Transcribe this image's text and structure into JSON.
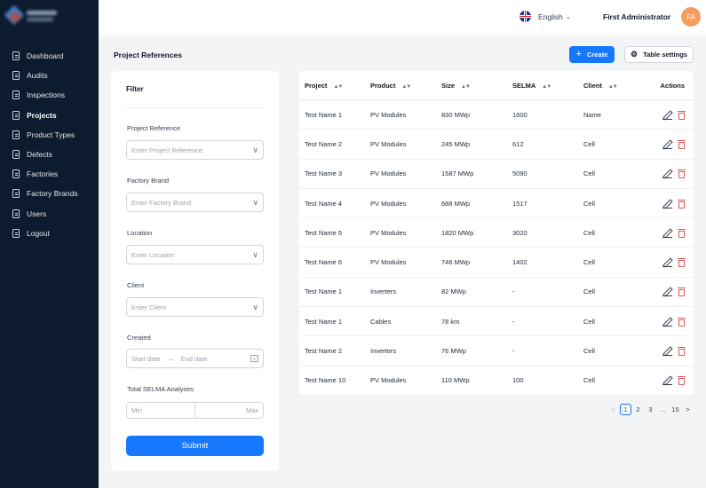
{
  "nav": {
    "items": [
      {
        "label": "Dashboard",
        "active": false
      },
      {
        "label": "Audits",
        "active": false
      },
      {
        "label": "Inspections",
        "active": false
      },
      {
        "label": "Projects",
        "active": true
      },
      {
        "label": "Product Types",
        "active": false
      },
      {
        "label": "Defects",
        "active": false
      },
      {
        "label": "Factories",
        "active": false
      },
      {
        "label": "Factory Brands",
        "active": false
      },
      {
        "label": "Users",
        "active": false
      },
      {
        "label": "Logout",
        "active": false
      }
    ]
  },
  "header": {
    "language": "English",
    "user_name": "First Administrator",
    "avatar_initials": "FA"
  },
  "page": {
    "title": "Project References",
    "create_label": "Create",
    "table_settings_label": "Table settings"
  },
  "filter": {
    "title": "Filter",
    "project_reference": {
      "label": "Project Reference",
      "placeholder": "Enter Project Reference"
    },
    "factory_brand": {
      "label": "Factory Brand",
      "placeholder": "Enter Factory Brand"
    },
    "location": {
      "label": "Location",
      "placeholder": "Enter Location"
    },
    "client": {
      "label": "Client",
      "placeholder": "Enter Client"
    },
    "created": {
      "label": "Created",
      "start_placeholder": "Start date",
      "end_placeholder": "End date"
    },
    "selma": {
      "label": "Total SELMA Analyses",
      "min_placeholder": "Min",
      "max_placeholder": "Max"
    },
    "submit_label": "Submit"
  },
  "table": {
    "columns": [
      "Project",
      "Product",
      "Size",
      "SELMA",
      "Client",
      "Actions"
    ],
    "rows": [
      {
        "project": "Test Name 1",
        "product": "PV Modules",
        "size": "830 MWp",
        "selma": "1600",
        "client": "Name"
      },
      {
        "project": "Test Name 2",
        "product": "PV Modules",
        "size": "245 MWp",
        "selma": "612",
        "client": "Cell"
      },
      {
        "project": "Test Name 3",
        "product": "PV Modules",
        "size": "1587 MWp",
        "selma": "5090",
        "client": "Cell"
      },
      {
        "project": "Test Name 4",
        "product": "PV Modules",
        "size": "688 MWp",
        "selma": "1517",
        "client": "Cell"
      },
      {
        "project": "Test Name 5",
        "product": "PV Modules",
        "size": "1820 MWp",
        "selma": "3020",
        "client": "Cell"
      },
      {
        "project": "Test Name 6",
        "product": "PV Modules",
        "size": "746 MWp",
        "selma": "1402",
        "client": "Cell"
      },
      {
        "project": "Test Name 1",
        "product": "Inverters",
        "size": "82 MWp",
        "selma": "-",
        "client": "Cell"
      },
      {
        "project": "Test Name 1",
        "product": "Cables",
        "size": "78 km",
        "selma": "-",
        "client": "Cell"
      },
      {
        "project": "Test Name 2",
        "product": "Inverters",
        "size": "76 MWp",
        "selma": "-",
        "client": "Cell"
      },
      {
        "project": "Test Name 10",
        "product": "PV Modules",
        "size": "110 MWp",
        "selma": "100",
        "client": "Cell"
      }
    ]
  },
  "pagination": {
    "prev": "<",
    "pages": [
      "1",
      "2",
      "3"
    ],
    "ellipsis": "...",
    "last": "15",
    "next": ">",
    "current": "1"
  }
}
